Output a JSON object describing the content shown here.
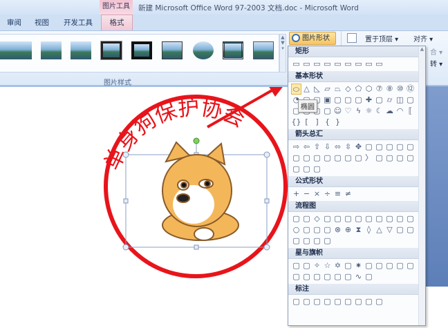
{
  "titlebar": {
    "context_tab": "图片工具",
    "title": "新建 Microsoft Office Word 97-2003 文档.doc - Microsoft Word"
  },
  "tabs": [
    {
      "label": "审阅"
    },
    {
      "label": "视图"
    },
    {
      "label": "开发工具"
    },
    {
      "label": "格式",
      "active": true
    }
  ],
  "ribbon": {
    "group_label": "图片样式",
    "shape_button": "图片形状 ▾",
    "bring_front": "置于顶层 ▾",
    "align": "对齐 ▾",
    "rotate": "合 ▾",
    "text_wrap": "转 ▾"
  },
  "dropdown": {
    "sections": [
      {
        "title": "矩形",
        "shapes": [
          "rect",
          "rect",
          "rect",
          "rect",
          "rect",
          "rect",
          "rect",
          "rect",
          "rect"
        ]
      },
      {
        "title": "基本形状",
        "shapes": [
          "oval",
          "triangle",
          "right-triangle",
          "parallelogram",
          "trapezoid",
          "diamond",
          "pentagon",
          "hexagon",
          "heptagon",
          "octagon",
          "decagon",
          "dodecagon",
          "pie",
          "chord",
          "teardrop",
          "frame",
          "half-frame",
          "l-shape",
          "diagonal-stripe",
          "cross",
          "plaque",
          "can",
          "cube",
          "bevel",
          "donut",
          "no-symbol",
          "block-arc",
          "folded-corner",
          "smiley",
          "heart",
          "lightning",
          "sun",
          "moon",
          "cloud",
          "arc",
          "double-bracket",
          "double-brace",
          "left-bracket",
          "right-bracket",
          "left-brace",
          "right-brace"
        ]
      },
      {
        "title": "箭头总汇",
        "shapes": [
          "right-arrow",
          "left-arrow",
          "up-arrow",
          "down-arrow",
          "left-right-arrow",
          "up-down-arrow",
          "quad-arrow",
          "left-right-up-arrow",
          "bent-arrow",
          "u-turn-arrow",
          "left-up-arrow",
          "bent-up-arrow",
          "curved-right-arrow",
          "curved-left-arrow",
          "curved-up-arrow",
          "curved-down-arrow",
          "striped-right-arrow",
          "notched-right-arrow",
          "pentagon-arrow",
          "chevron",
          "right-arrow-callout",
          "down-arrow-callout",
          "left-arrow-callout",
          "up-arrow-callout",
          "left-right-arrow-callout",
          "quad-arrow-callout",
          "circular-arrow"
        ]
      },
      {
        "title": "公式形状",
        "shapes": [
          "plus",
          "minus",
          "multiply",
          "divide",
          "equal",
          "not-equal"
        ]
      },
      {
        "title": "流程图",
        "shapes": [
          "process",
          "alternate-process",
          "decision",
          "data",
          "predefined-process",
          "internal-storage",
          "document",
          "multidocument",
          "terminator",
          "preparation",
          "manual-input",
          "manual-operation",
          "connector",
          "offpage-connector",
          "card",
          "punched-tape",
          "summing-junction",
          "or",
          "collate",
          "sort",
          "extract",
          "merge",
          "stored-data",
          "delay",
          "sequential-access",
          "magnetic-disk",
          "direct-access",
          "display"
        ]
      },
      {
        "title": "星与旗帜",
        "shapes": [
          "explosion-1",
          "explosion-2",
          "star-4",
          "star-5",
          "star-6",
          "star-7",
          "star-8",
          "star-10",
          "star-12",
          "star-16",
          "star-24",
          "star-32",
          "ribbon-up",
          "ribbon-down",
          "curved-ribbon-up",
          "curved-ribbon-down",
          "vertical-scroll",
          "horizontal-scroll",
          "wave",
          "double-wave"
        ]
      },
      {
        "title": "标注",
        "shapes": [
          "rect-callout",
          "rounded-callout",
          "oval-callout",
          "cloud-callout",
          "line-callout-1",
          "line-callout-2",
          "line-callout-3",
          "line-callout-4",
          "line-callout-5"
        ]
      }
    ]
  },
  "tooltip": "椭圆",
  "document": {
    "stamp_text": "单身狗保护协会",
    "stamp_color": "#e8141b"
  }
}
